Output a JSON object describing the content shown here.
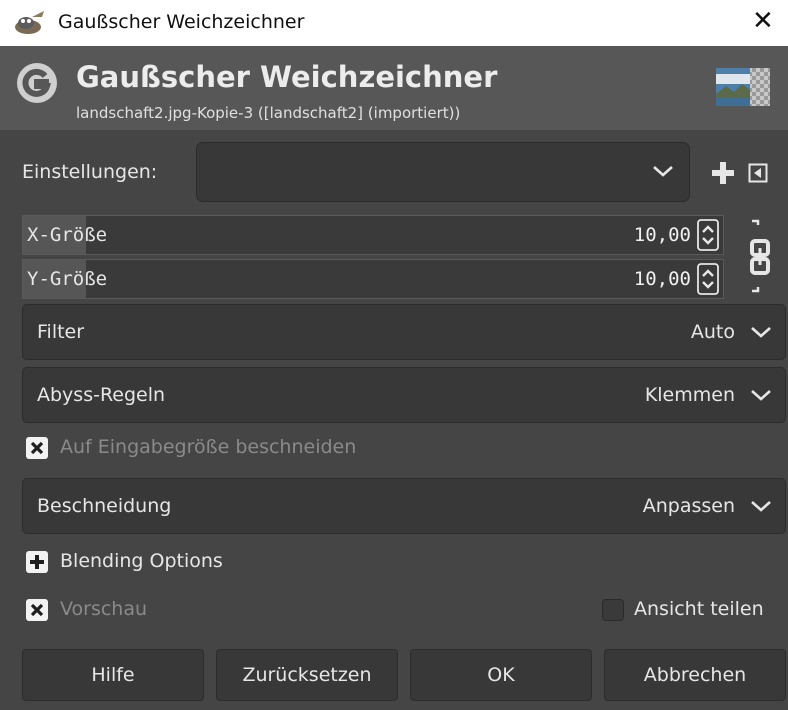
{
  "window": {
    "title": "Gaußscher Weichzeichner",
    "close_glyph": "✕"
  },
  "header": {
    "title": "Gaußscher Weichzeichner",
    "subtitle": "landschaft2.jpg-Kopie-3 ([landschaft2] (importiert))"
  },
  "settings": {
    "label": "Einstellungen:",
    "value": ""
  },
  "size_x": {
    "label": "X-Größe",
    "value": "10,00",
    "fill_fraction": 0.09
  },
  "size_y": {
    "label": "Y-Größe",
    "value": "10,00",
    "fill_fraction": 0.09
  },
  "filter": {
    "label": "Filter",
    "value": "Auto"
  },
  "abyss": {
    "label": "Abyss-Regeln",
    "value": "Klemmen"
  },
  "clip_input": {
    "label": "Auf Eingabegröße beschneiden",
    "checked": true
  },
  "clipping": {
    "label": "Beschneidung",
    "value": "Anpassen"
  },
  "blending": {
    "label": "Blending Options"
  },
  "preview": {
    "label": "Vorschau",
    "checked": true
  },
  "split_view": {
    "label": "Ansicht teilen",
    "checked": false
  },
  "buttons": {
    "help": "Hilfe",
    "reset": "Zurücksetzen",
    "ok": "OK",
    "cancel": "Abbrechen"
  },
  "icons": [
    "gimp-app-icon",
    "close-icon",
    "gegl-logo-icon",
    "image-thumbnail",
    "chevron-down-icon",
    "add-preset-icon",
    "preset-menu-icon",
    "spin-arrows-icon",
    "chain-link-icon",
    "checkbox-checked-icon",
    "expand-plus-icon"
  ],
  "colors": {
    "background": "#454545",
    "header_bg": "#575757",
    "widget_bg": "#383838",
    "text": "#e6e6e6",
    "dim_text": "#8a8a8a"
  }
}
